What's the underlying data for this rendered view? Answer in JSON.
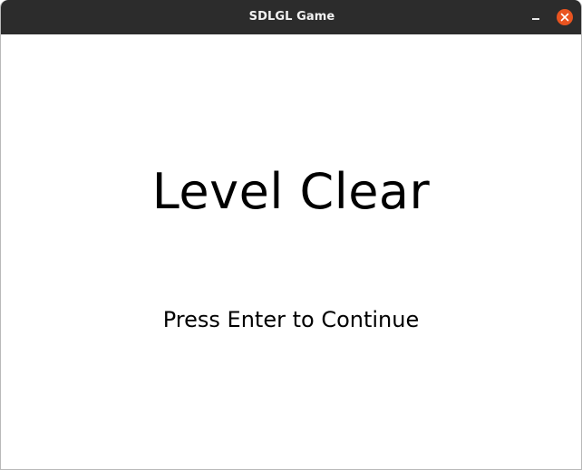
{
  "window": {
    "title": "SDLGL Game",
    "controls": {
      "minimize_icon": "minimize-icon",
      "close_icon": "close-icon"
    },
    "colors": {
      "titlebar": "#2c2c2c",
      "close_button": "#e95420",
      "background": "#ffffff",
      "text": "#000000"
    }
  },
  "screen": {
    "heading": "Level Clear",
    "prompt": "Press Enter to Continue"
  }
}
